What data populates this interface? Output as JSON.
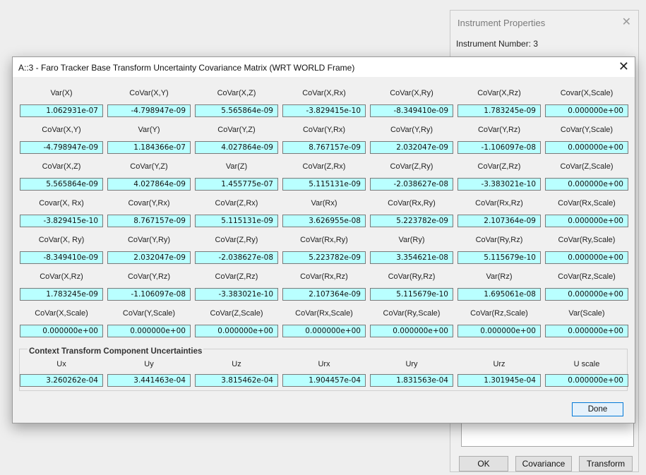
{
  "instrument_properties": {
    "title": "Instrument Properties",
    "instrument_number_label": "Instrument Number:",
    "instrument_number_value": "3",
    "buttons": {
      "ok": "OK",
      "covariance": "Covariance",
      "transform": "Transform"
    }
  },
  "dialog": {
    "title": "A::3 - Faro Tracker Base Transform Uncertainty Covariance Matrix (WRT WORLD Frame)",
    "close_glyph": "✕",
    "matrix": {
      "rows": [
        {
          "labels": [
            "Var(X)",
            "CoVar(X,Y)",
            "CoVar(X,Z)",
            "CoVar(X,Rx)",
            "CoVar(X,Ry)",
            "CoVar(X,Rz)",
            "Covar(X,Scale)"
          ],
          "values": [
            "1.062931e-07",
            "-4.798947e-09",
            "5.565864e-09",
            "-3.829415e-10",
            "-8.349410e-09",
            "1.783245e-09",
            "0.000000e+00"
          ]
        },
        {
          "labels": [
            "CoVar(X,Y)",
            "Var(Y)",
            "CoVar(Y,Z)",
            "CoVar(Y,Rx)",
            "CoVar(Y,Ry)",
            "CoVar(Y,Rz)",
            "CoVar(Y,Scale)"
          ],
          "values": [
            "-4.798947e-09",
            "1.184366e-07",
            "4.027864e-09",
            "8.767157e-09",
            "2.032047e-09",
            "-1.106097e-08",
            "0.000000e+00"
          ]
        },
        {
          "labels": [
            "CoVar(X,Z)",
            "CoVar(Y,Z)",
            "Var(Z)",
            "CoVar(Z,Rx)",
            "CoVar(Z,Ry)",
            "CoVar(Z,Rz)",
            "CoVar(Z,Scale)"
          ],
          "values": [
            "5.565864e-09",
            "4.027864e-09",
            "1.455775e-07",
            "5.115131e-09",
            "-2.038627e-08",
            "-3.383021e-10",
            "0.000000e+00"
          ]
        },
        {
          "labels": [
            "Covar(X, Rx)",
            "Covar(Y,Rx)",
            "CoVar(Z,Rx)",
            "Var(Rx)",
            "CoVar(Rx,Ry)",
            "CoVar(Rx,Rz)",
            "CoVar(Rx,Scale)"
          ],
          "values": [
            "-3.829415e-10",
            "8.767157e-09",
            "5.115131e-09",
            "3.626955e-08",
            "5.223782e-09",
            "2.107364e-09",
            "0.000000e+00"
          ]
        },
        {
          "labels": [
            "CoVar(X, Ry)",
            "CoVar(Y,Ry)",
            "CoVar(Z,Ry)",
            "CoVar(Rx,Ry)",
            "Var(Ry)",
            "CoVar(Ry,Rz)",
            "CoVar(Ry,Scale)"
          ],
          "values": [
            "-8.349410e-09",
            "2.032047e-09",
            "-2.038627e-08",
            "5.223782e-09",
            "3.354621e-08",
            "5.115679e-10",
            "0.000000e+00"
          ]
        },
        {
          "labels": [
            "CoVar(X,Rz)",
            "CoVar(Y,Rz)",
            "CoVar(Z,Rz)",
            "CoVar(Rx,Rz)",
            "CoVar(Ry,Rz)",
            "Var(Rz)",
            "CoVar(Rz,Scale)"
          ],
          "values": [
            "1.783245e-09",
            "-1.106097e-08",
            "-3.383021e-10",
            "2.107364e-09",
            "5.115679e-10",
            "1.695061e-08",
            "0.000000e+00"
          ]
        },
        {
          "labels": [
            "CoVar(X,Scale)",
            "CoVar(Y,Scale)",
            "CoVar(Z,Scale)",
            "CoVar(Rx,Scale)",
            "CoVar(Ry,Scale)",
            "CoVar(Rz,Scale)",
            "Var(Scale)"
          ],
          "values": [
            "0.000000e+00",
            "0.000000e+00",
            "0.000000e+00",
            "0.000000e+00",
            "0.000000e+00",
            "0.000000e+00",
            "0.000000e+00"
          ]
        }
      ]
    },
    "context_section": {
      "title": "Context Transform Component Uncertainties",
      "labels": [
        "Ux",
        "Uy",
        "Uz",
        "Urx",
        "Ury",
        "Urz",
        "U scale"
      ],
      "values": [
        "3.260262e-04",
        "3.441463e-04",
        "3.815462e-04",
        "1.904457e-04",
        "1.831563e-04",
        "1.301945e-04",
        "0.000000e+00"
      ]
    },
    "done_label": "Done"
  },
  "colors": {
    "field_bg": "#b9ffff",
    "accent": "#0078d7"
  }
}
